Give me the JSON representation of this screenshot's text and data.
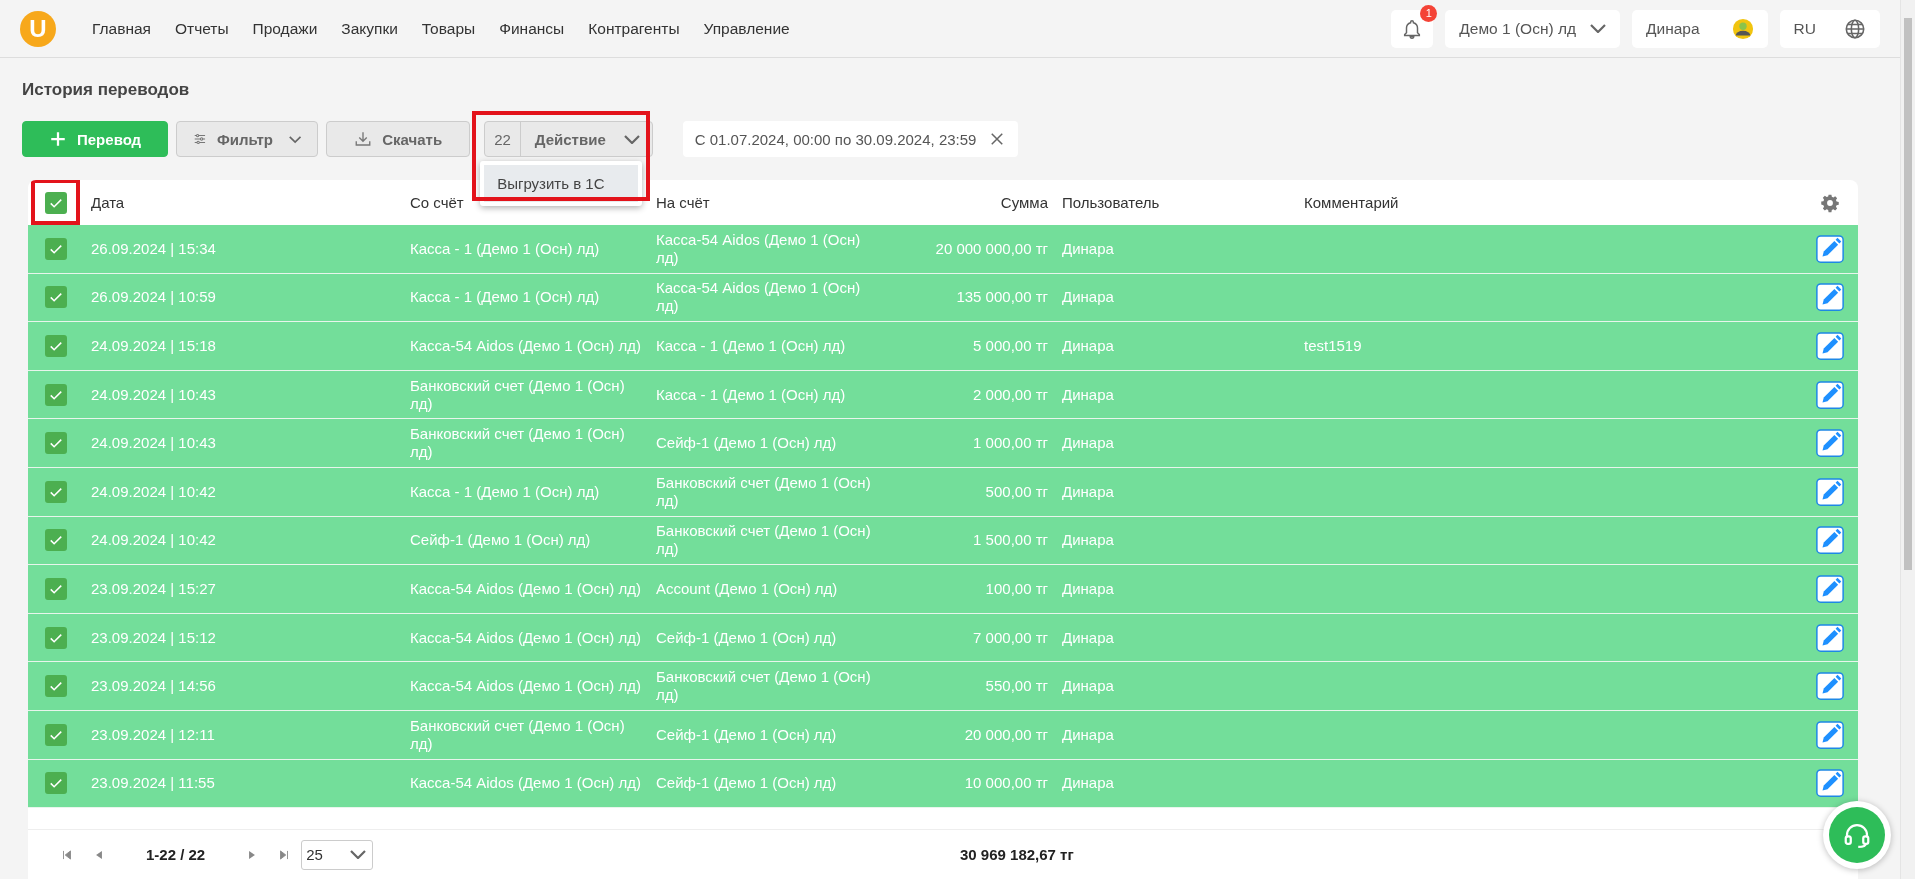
{
  "nav": {
    "logo": "U",
    "items": [
      "Главная",
      "Отчеты",
      "Продажи",
      "Закупки",
      "Товары",
      "Финансы",
      "Контрагенты",
      "Управление"
    ]
  },
  "header_right": {
    "notification_badge": "1",
    "organization": "Демо 1 (Осн) лд",
    "user": "Динара",
    "language": "RU"
  },
  "page_title": "История переводов",
  "toolbar": {
    "add_button": "Перевод",
    "filter_button": "Фильтр",
    "download_button": "Скачать",
    "action": {
      "count": "22",
      "label": "Действие",
      "expanded": true,
      "highlighted": true,
      "menu": [
        "Выгрузить в 1С"
      ]
    },
    "date_range": "С 01.07.2024, 00:00 по 30.09.2024, 23:59"
  },
  "table": {
    "select_all": {
      "checked": true,
      "highlighted": true
    },
    "columns": [
      "Дата",
      "Со счёт",
      "На счёт",
      "Сумма",
      "Пользователь",
      "Комментарий"
    ],
    "rows": [
      {
        "checked": true,
        "date": "26.09.2024 | 15:34",
        "from": "Касса - 1 (Демо 1 (Осн) лд)",
        "to": "Касса-54 Aidos (Демо 1 (Осн) лд)",
        "amount": "20 000 000,00 тг",
        "user": "Динара"
      },
      {
        "checked": true,
        "date": "26.09.2024 | 10:59",
        "from": "Касса - 1 (Демо 1 (Осн) лд)",
        "to": "Касса-54 Aidos (Демо 1 (Осн) лд)",
        "amount": "135 000,00 тг",
        "user": "Динара"
      },
      {
        "checked": true,
        "date": "24.09.2024 | 15:18",
        "from": "Касса-54 Aidos (Демо 1 (Осн) лд)",
        "to": "Касса - 1 (Демо 1 (Осн) лд)",
        "amount": "5 000,00 тг",
        "user": "Динара",
        "comment": "test1519"
      },
      {
        "checked": true,
        "date": "24.09.2024 | 10:43",
        "from": "Банковский счет (Демо 1 (Осн) лд)",
        "to": "Касса - 1 (Демо 1 (Осн) лд)",
        "amount": "2 000,00 тг",
        "user": "Динара"
      },
      {
        "checked": true,
        "date": "24.09.2024 | 10:43",
        "from": "Банковский счет (Демо 1 (Осн) лд)",
        "to": "Сейф-1 (Демо 1 (Осн) лд)",
        "amount": "1 000,00 тг",
        "user": "Динара"
      },
      {
        "checked": true,
        "date": "24.09.2024 | 10:42",
        "from": "Касса - 1 (Демо 1 (Осн) лд)",
        "to": "Банковский счет (Демо 1 (Осн) лд)",
        "amount": "500,00 тг",
        "user": "Динара"
      },
      {
        "checked": true,
        "date": "24.09.2024 | 10:42",
        "from": "Сейф-1 (Демо 1 (Осн) лд)",
        "to": "Банковский счет (Демо 1 (Осн) лд)",
        "amount": "1 500,00 тг",
        "user": "Динара"
      },
      {
        "checked": true,
        "date": "23.09.2024 | 15:27",
        "from": "Касса-54 Aidos (Демо 1 (Осн) лд)",
        "to": "Account (Демо 1 (Осн) лд)",
        "amount": "100,00 тг",
        "user": "Динара"
      },
      {
        "checked": true,
        "date": "23.09.2024 | 15:12",
        "from": "Касса-54 Aidos (Демо 1 (Осн) лд)",
        "to": "Сейф-1 (Демо 1 (Осн) лд)",
        "amount": "7 000,00 тг",
        "user": "Динара"
      },
      {
        "checked": true,
        "date": "23.09.2024 | 14:56",
        "from": "Касса-54 Aidos (Демо 1 (Осн) лд)",
        "to": "Банковский счет (Демо 1 (Осн) лд)",
        "amount": "550,00 тг",
        "user": "Динара"
      },
      {
        "checked": true,
        "date": "23.09.2024 | 12:11",
        "from": "Банковский счет (Демо 1 (Осн) лд)",
        "to": "Сейф-1 (Демо 1 (Осн) лд)",
        "amount": "20 000,00 тг",
        "user": "Динара"
      },
      {
        "checked": true,
        "date": "23.09.2024 | 11:55",
        "from": "Касса-54 Aidos (Демо 1 (Осн) лд)",
        "to": "Сейф-1 (Демо 1 (Осн) лд)",
        "amount": "10 000,00 тг",
        "user": "Динара"
      }
    ]
  },
  "footer": {
    "range": "1-22 / 22",
    "page_size": "25",
    "total": "30 969 182,67 тг"
  }
}
